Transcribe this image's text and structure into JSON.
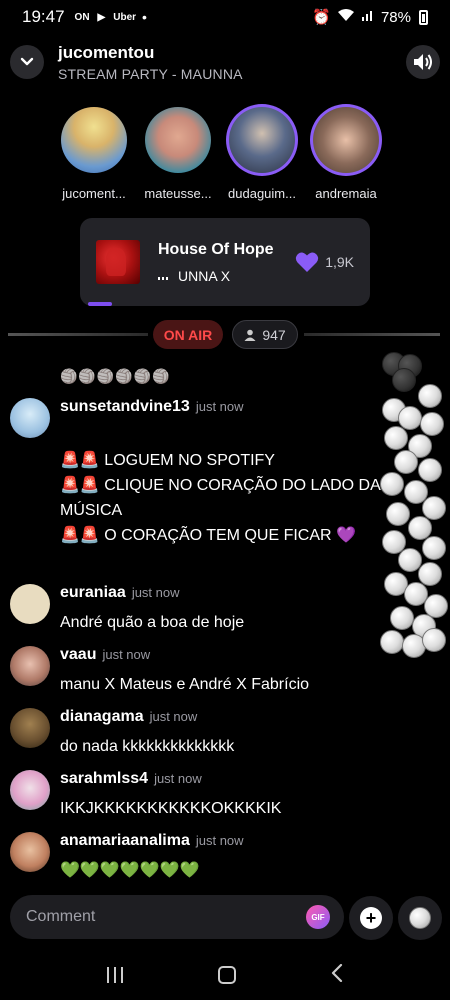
{
  "status_bar": {
    "time": "19:47",
    "apps": [
      "ON",
      "▶",
      "Uber"
    ],
    "dot": "•",
    "battery": "78%"
  },
  "header": {
    "title": "jucomentou",
    "subtitle": "STREAM PARTY - MAUNNA"
  },
  "participants": [
    {
      "name": "jucoment...",
      "color": "#d9b36a",
      "active": false
    },
    {
      "name": "mateusse...",
      "color": "#c88a7a",
      "active": false
    },
    {
      "name": "dudaguim...",
      "color": "#5a6a8a",
      "active": true
    },
    {
      "name": "andremaia",
      "color": "#8a6a5a",
      "active": true
    }
  ],
  "now_playing": {
    "title": "House Of Hope",
    "artist": "UNNA X",
    "likes": "1,9K"
  },
  "live": {
    "on_air_label": "ON AIR",
    "viewers": "947"
  },
  "chat": {
    "partial_emoji": "🏐🏐🏐🏐🏐🏐",
    "comments": [
      {
        "user": "sunsetandvine13",
        "time": "just now",
        "avatar_color": "#9ac0e0",
        "lines": [
          "🚨🚨 LOGUEM NO SPOTIFY",
          "🚨🚨 CLIQUE NO CORAÇÃO DO LADO DA MÚSICA",
          "🚨🚨 O CORAÇÃO TEM QUE FICAR 💜"
        ]
      },
      {
        "user": "euraniaa",
        "time": "just now",
        "avatar_color": "#e8dcc0",
        "lines": [
          "André quão a boa de hoje"
        ]
      },
      {
        "user": "vaau",
        "time": "just now",
        "avatar_color": "#b07a68",
        "lines": [
          "manu X Mateus e André X Fabrício"
        ]
      },
      {
        "user": "dianagama",
        "time": "just now",
        "avatar_color": "#6a5030",
        "lines": [
          "do nada kkkkkkkkkkkkkk"
        ]
      },
      {
        "user": "sarahmlss4",
        "time": "just now",
        "avatar_color": "#e0a0c8",
        "lines": [
          "IKKJKKKKKKKKKKKOKKKKIK"
        ]
      },
      {
        "user": "anamariaanalima",
        "time": "just now",
        "avatar_color": "#c08060",
        "lines": [
          "💚💚💚💚💚💚💚"
        ]
      }
    ]
  },
  "composer": {
    "placeholder": "Comment",
    "gif_label": "GIF"
  },
  "icons": {
    "back": "chevron-down-icon",
    "sound": "speaker-icon",
    "like": "heart-icon",
    "viewers": "person-icon",
    "add": "plus-icon",
    "reaction": "volleyball-icon"
  }
}
